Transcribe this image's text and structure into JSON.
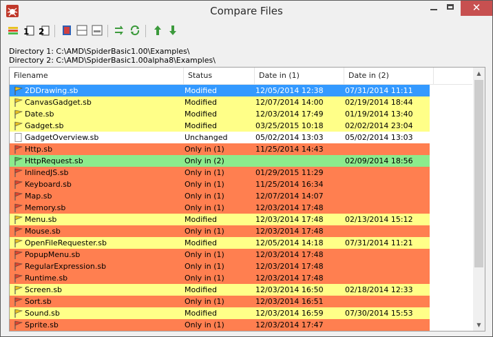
{
  "window": {
    "title": "Compare Files",
    "close_glyph": "✕"
  },
  "toolbar": {
    "buttons": [
      {
        "name": "compare-list-icon",
        "color": "#d4a017"
      },
      {
        "name": "file-1-icon",
        "label": "1"
      },
      {
        "name": "file-2-icon",
        "label": "2"
      },
      {
        "name": "side-by-side-icon",
        "color": "#2d5fb4"
      },
      {
        "name": "split-horizontal-icon"
      },
      {
        "name": "split-single-icon"
      },
      {
        "name": "swap-arrows-icon",
        "color": "#3c9a3c"
      },
      {
        "name": "refresh-icon",
        "color": "#3c9a3c"
      },
      {
        "name": "arrow-up-icon",
        "color": "#3c9a3c"
      },
      {
        "name": "arrow-down-icon",
        "color": "#3c9a3c"
      }
    ]
  },
  "directories": {
    "dir1": "Directory 1: C:\\AMD\\SpiderBasic1.00\\Examples\\",
    "dir2": "Directory 2: C:\\AMD\\SpiderBasic1.00alpha8\\Examples\\"
  },
  "columns": {
    "filename": "Filename",
    "status": "Status",
    "date1": "Date in (1)",
    "date2": "Date in (2)"
  },
  "colors": {
    "selected": "#3399ff",
    "modified": "#ffff88",
    "unchanged": "#ffffff",
    "only1": "#ff7f50",
    "only2": "#8ceb8c",
    "flag_modified": "#e8c020",
    "flag_only1": "#e0442c",
    "flag_only2": "#4cbb4c"
  },
  "rows": [
    {
      "name": "2DDrawing.sb",
      "status": "Modified",
      "date1": "12/05/2014 12:38",
      "date2": "07/31/2014 11:11",
      "kind": "selected"
    },
    {
      "name": "CanvasGadget.sb",
      "status": "Modified",
      "date1": "12/07/2014 14:00",
      "date2": "02/19/2014 18:44",
      "kind": "modified"
    },
    {
      "name": "Date.sb",
      "status": "Modified",
      "date1": "12/03/2014 17:49",
      "date2": "01/19/2014 13:40",
      "kind": "modified"
    },
    {
      "name": "Gadget.sb",
      "status": "Modified",
      "date1": "03/25/2015 10:18",
      "date2": "02/02/2014 23:04",
      "kind": "modified"
    },
    {
      "name": "GadgetOverview.sb",
      "status": "Unchanged",
      "date1": "05/02/2014 13:03",
      "date2": "05/02/2014 13:03",
      "kind": "unchanged"
    },
    {
      "name": "Http.sb",
      "status": "Only in (1)",
      "date1": "11/25/2014 14:43",
      "date2": "",
      "kind": "only1"
    },
    {
      "name": "HttpRequest.sb",
      "status": "Only in (2)",
      "date1": "",
      "date2": "02/09/2014 18:56",
      "kind": "only2"
    },
    {
      "name": "InlinedJS.sb",
      "status": "Only in (1)",
      "date1": "01/29/2015 11:29",
      "date2": "",
      "kind": "only1"
    },
    {
      "name": "Keyboard.sb",
      "status": "Only in (1)",
      "date1": "11/25/2014 16:34",
      "date2": "",
      "kind": "only1"
    },
    {
      "name": "Map.sb",
      "status": "Only in (1)",
      "date1": "12/07/2014 14:07",
      "date2": "",
      "kind": "only1"
    },
    {
      "name": "Memory.sb",
      "status": "Only in (1)",
      "date1": "12/03/2014 17:48",
      "date2": "",
      "kind": "only1"
    },
    {
      "name": "Menu.sb",
      "status": "Modified",
      "date1": "12/03/2014 17:48",
      "date2": "02/13/2014 15:12",
      "kind": "modified"
    },
    {
      "name": "Mouse.sb",
      "status": "Only in (1)",
      "date1": "12/03/2014 17:48",
      "date2": "",
      "kind": "only1"
    },
    {
      "name": "OpenFileRequester.sb",
      "status": "Modified",
      "date1": "12/05/2014 14:18",
      "date2": "07/31/2014 11:21",
      "kind": "modified"
    },
    {
      "name": "PopupMenu.sb",
      "status": "Only in (1)",
      "date1": "12/03/2014 17:48",
      "date2": "",
      "kind": "only1"
    },
    {
      "name": "RegularExpression.sb",
      "status": "Only in (1)",
      "date1": "12/03/2014 17:48",
      "date2": "",
      "kind": "only1"
    },
    {
      "name": "Runtime.sb",
      "status": "Only in (1)",
      "date1": "12/03/2014 17:48",
      "date2": "",
      "kind": "only1"
    },
    {
      "name": "Screen.sb",
      "status": "Modified",
      "date1": "12/03/2014 16:50",
      "date2": "02/18/2014 12:33",
      "kind": "modified"
    },
    {
      "name": "Sort.sb",
      "status": "Only in (1)",
      "date1": "12/03/2014 16:51",
      "date2": "",
      "kind": "only1"
    },
    {
      "name": "Sound.sb",
      "status": "Modified",
      "date1": "12/03/2014 16:59",
      "date2": "07/30/2014 15:53",
      "kind": "modified"
    },
    {
      "name": "Sprite.sb",
      "status": "Only in (1)",
      "date1": "12/03/2014 17:47",
      "date2": "",
      "kind": "only1"
    }
  ]
}
